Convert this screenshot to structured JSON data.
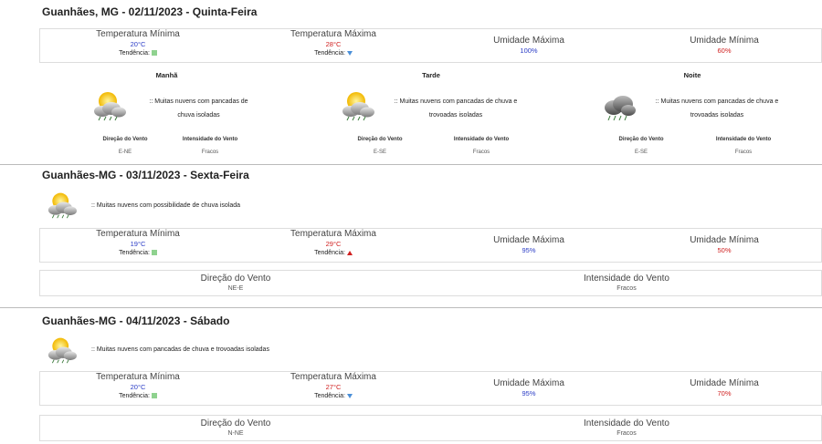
{
  "days": [
    {
      "title": "Guanhães, MG - 02/11/2023 - Quinta-Feira",
      "min_temp_label": "Temperatura Mínima",
      "min_temp": "20°C",
      "max_temp_label": "Temperatura Máxima",
      "max_temp": "28°C",
      "trend_label": "Tendência:",
      "hum_max_label": "Umidade Máxima",
      "hum_max": "100%",
      "hum_min_label": "Umidade Mínima",
      "hum_min": "60%",
      "periods": [
        {
          "name": "Manhã",
          "desc_1": ":: Muitas nuvens com pancadas de",
          "desc_2": "chuva isoladas",
          "wind_dir_label": "Direção do Vento",
          "wind_dir": "E-NE",
          "wind_int_label": "Intensidade do Vento",
          "wind_int": "Fracos"
        },
        {
          "name": "Tarde",
          "desc_1": ":: Muitas nuvens com pancadas de chuva e",
          "desc_2": "trovoadas isoladas",
          "wind_dir_label": "Direção do Vento",
          "wind_dir": "E-SE",
          "wind_int_label": "Intensidade do Vento",
          "wind_int": "Fracos"
        },
        {
          "name": "Noite",
          "desc_1": ":: Muitas nuvens com pancadas de chuva e",
          "desc_2": "trovoadas isoladas",
          "wind_dir_label": "Direção do Vento",
          "wind_dir": "E-SE",
          "wind_int_label": "Intensidade do Vento",
          "wind_int": "Fracos"
        }
      ]
    },
    {
      "title": "Guanhães-MG - 03/11/2023 - Sexta-Feira",
      "desc": ":: Muitas nuvens com possibilidade de chuva isolada",
      "min_temp_label": "Temperatura Mínima",
      "min_temp": "19°C",
      "max_temp_label": "Temperatura Máxima",
      "max_temp": "29°C",
      "trend_label": "Tendência:",
      "hum_max_label": "Umidade Máxima",
      "hum_max": "95%",
      "hum_min_label": "Umidade Mínima",
      "hum_min": "50%",
      "wind_dir_label": "Direção do Vento",
      "wind_dir": "NE-E",
      "wind_int_label": "Intensidade do Vento",
      "wind_int": "Fracos"
    },
    {
      "title": "Guanhães-MG - 04/11/2023 - Sábado",
      "desc": ":: Muitas nuvens com pancadas de chuva e trovoadas isoladas",
      "min_temp_label": "Temperatura Mínima",
      "min_temp": "20°C",
      "max_temp_label": "Temperatura Máxima",
      "max_temp": "27°C",
      "trend_label": "Tendência:",
      "hum_max_label": "Umidade Máxima",
      "hum_max": "95%",
      "hum_min_label": "Umidade Mínima",
      "hum_min": "70%",
      "wind_dir_label": "Direção do Vento",
      "wind_dir": "N-NE",
      "wind_int_label": "Intensidade do Vento",
      "wind_int": "Fracos"
    }
  ],
  "colors": {
    "min": "#2a3cc6",
    "max": "#d02020",
    "trend_stable": "#8fd28f",
    "trend_down": "#4a8fd8",
    "trend_up": "#d02020"
  }
}
